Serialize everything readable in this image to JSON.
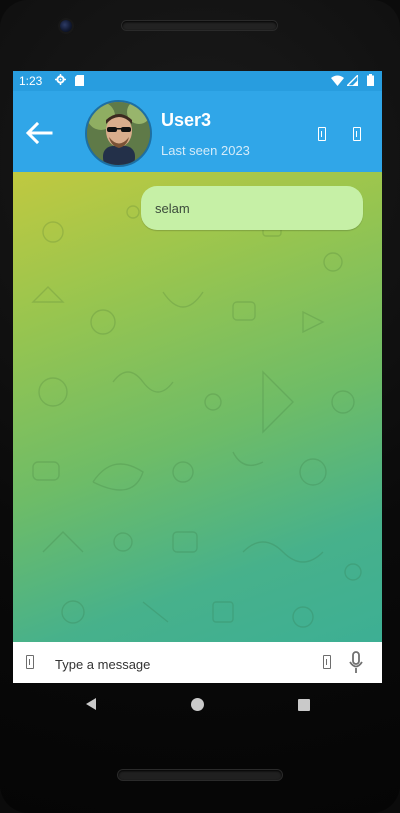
{
  "status_bar": {
    "time": "1:23"
  },
  "header": {
    "title": "User3",
    "subtitle": "Last seen 2023"
  },
  "messages": [
    {
      "text": "selam",
      "direction": "outgoing"
    }
  ],
  "composer": {
    "placeholder": "Type a message"
  },
  "colors": {
    "app_bar": "#30a6e8",
    "status_bar": "#289ddf",
    "bubble": "#c6f0a6",
    "chat_bg_top": "#c0c940",
    "chat_bg_bottom": "#3daf94"
  },
  "icons": {
    "back": "arrow-left-icon",
    "action_1": "video-call-icon",
    "action_2": "voice-call-icon",
    "emoji": "emoji-icon",
    "attach": "attach-icon",
    "mic": "microphone-icon"
  }
}
